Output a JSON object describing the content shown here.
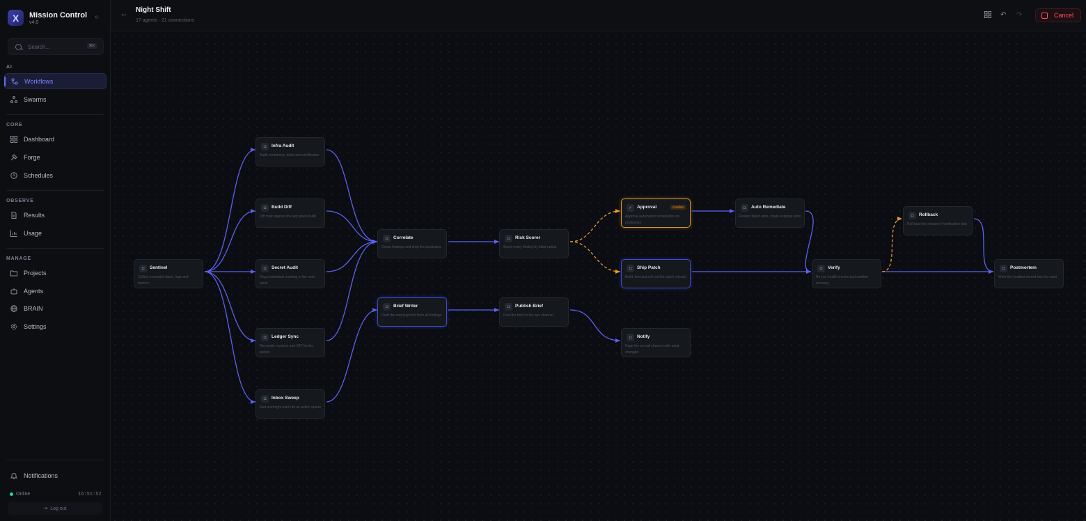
{
  "app": {
    "name": "Mission Control",
    "version": "v4.0"
  },
  "search": {
    "placeholder": "Search...",
    "shortcut": "⌘K"
  },
  "sections": {
    "ai": "AI",
    "core": "CORE",
    "observe": "OBSERVE",
    "manage": "MANAGE"
  },
  "nav": {
    "workflows": "Workflows",
    "swarms": "Swarms",
    "dashboard": "Dashboard",
    "forge": "Forge",
    "schedules": "Schedules",
    "results": "Results",
    "usage": "Usage",
    "projects": "Projects",
    "agents": "Agents",
    "brain": "BRAIN",
    "settings": "Settings",
    "notifications": "Notifications"
  },
  "status": {
    "label": "Online",
    "time": "16:51:52",
    "logout": "Log out"
  },
  "workflow": {
    "title": "Night Shift",
    "subtitle": "17 agents · 21 connections",
    "cancel": "Cancel"
  },
  "nodes": {
    "sentinel": {
      "title": "Sentinel",
      "desc": "Collect overnight alerts, logs and metrics"
    },
    "infra_audit": {
      "title": "Infra Audit",
      "desc": "Audit containers, disks and certificates"
    },
    "build_diff": {
      "title": "Build Diff",
      "desc": "Diff main against the last green build"
    },
    "secret_audit": {
      "title": "Secret Audit",
      "desc": "Flag credentials expiring in the next week"
    },
    "ledger_sync": {
      "title": "Ledger Sync",
      "desc": "Reconcile invoices and VAT for the period"
    },
    "inbox_sweep": {
      "title": "Inbox Sweep",
      "desc": "Sort overnight mail into an action queue"
    },
    "correlate": {
      "title": "Correlate",
      "desc": "Group findings and drop the duplicates"
    },
    "brief_writer": {
      "title": "Brief Writer",
      "desc": "Draft the morning brief from all findings"
    },
    "risk_scorer": {
      "title": "Risk Scorer",
      "desc": "Score every finding by blast radius"
    },
    "publish_brief": {
      "title": "Publish Brief",
      "desc": "Post the brief to the ops channel"
    },
    "approval": {
      "title": "Approval",
      "desc": "Approve automated remediation on production",
      "badge": "Confirm"
    },
    "ship_patch": {
      "title": "Ship Patch",
      "desc": "Build, test and roll out the patch release"
    },
    "notify": {
      "title": "Notify",
      "desc": "Page the on-call channel with what changed"
    },
    "auto_remediate": {
      "title": "Auto Remediate",
      "desc": "Restart failed units, rotate expiring certs"
    },
    "verify": {
      "title": "Verify",
      "desc": "Re-run health checks and confirm recovery"
    },
    "rollback": {
      "title": "Rollback",
      "desc": "Roll back the release if verification fails"
    },
    "postmortem": {
      "title": "Postmortem",
      "desc": "Write the incident record into the vault"
    }
  },
  "colors": {
    "edge": "#5b62f0",
    "edge_conditional": "#e69a2e",
    "accent": "#7a84ff",
    "danger": "#ff4d5a",
    "online": "#2fd58c"
  }
}
